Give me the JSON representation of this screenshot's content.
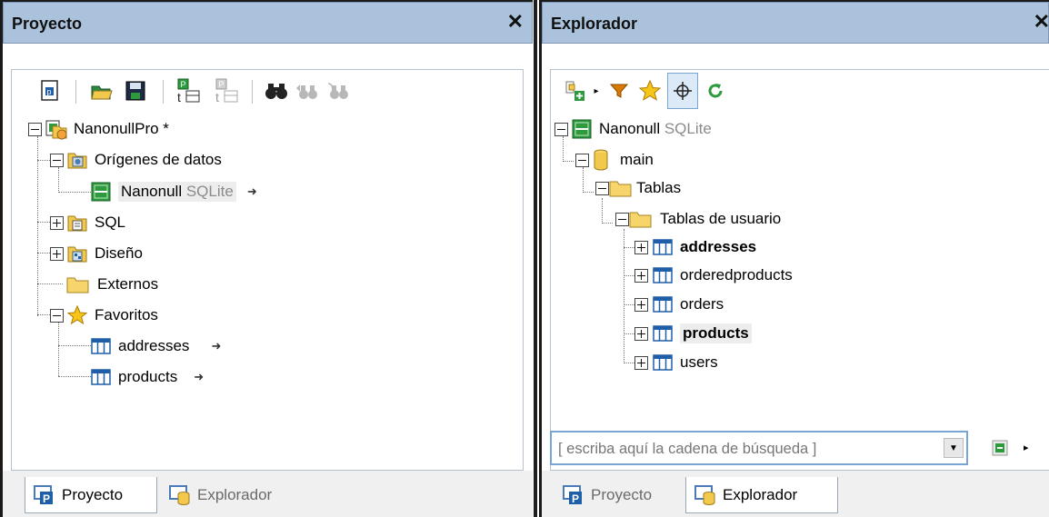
{
  "project": {
    "title": "Proyecto",
    "close": "✕",
    "tree": {
      "root": "NanonullPro *",
      "data_sources": "Orígenes de datos",
      "nanonull_name": "Nanonull",
      "nanonull_type": "SQLite",
      "sql": "SQL",
      "design": "Diseño",
      "external": "Externos",
      "favorites": "Favoritos",
      "fav_addresses": "addresses",
      "fav_products": "products"
    },
    "tabs": {
      "project": "Proyecto",
      "explorer": "Explorador"
    }
  },
  "explorer": {
    "title": "Explorador",
    "close": "✕",
    "tree": {
      "root_name": "Nanonull",
      "root_type": "SQLite",
      "main": "main",
      "tables": "Tablas",
      "user_tables": "Tablas de usuario",
      "t_addresses": "addresses",
      "t_orderedproducts": "orderedproducts",
      "t_orders": "orders",
      "t_products": "products",
      "t_users": "users"
    },
    "search": {
      "placeholder": "[ escriba aquí la cadena de búsqueda ]"
    },
    "tabs": {
      "project": "Proyecto",
      "explorer": "Explorador"
    }
  },
  "colors": {
    "titlebar": "#abc2dc",
    "accent_green": "#2e9a3e",
    "folder": "#f2c94c",
    "table_blue": "#1e5fa8"
  }
}
